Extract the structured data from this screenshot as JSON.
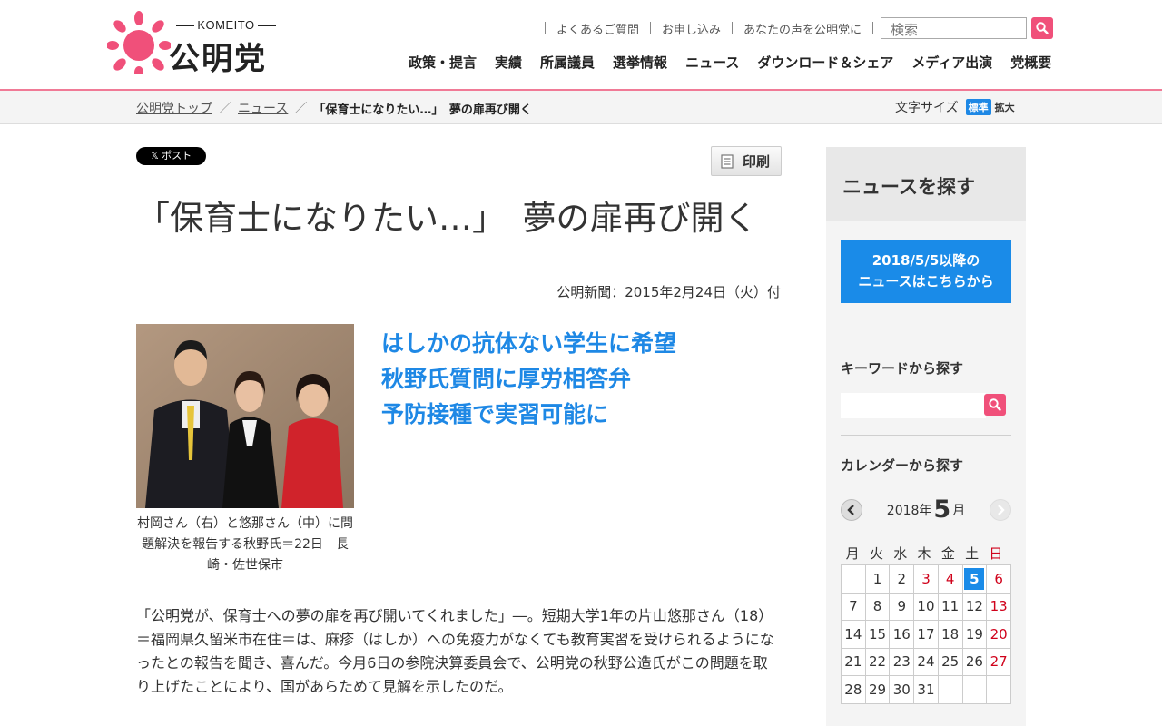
{
  "header": {
    "logo_sub": "KOMEITO",
    "logo_name": "公明党",
    "util_links": [
      "よくあるご質問",
      "お申し込み",
      "あなたの声を公明党に"
    ],
    "search_placeholder": "検索",
    "nav": [
      "政策・提言",
      "実績",
      "所属議員",
      "選挙情報",
      "ニュース",
      "ダウンロード＆シェア",
      "メディア出演",
      "党概要"
    ]
  },
  "breadcrumb": {
    "items": [
      "公明党トップ",
      "ニュース"
    ],
    "current": "「保育士になりたい…」　夢の扉再び開く"
  },
  "font_size": {
    "label": "文字サイズ",
    "standard": "標準",
    "large": "拡大"
  },
  "article": {
    "x_post_label": "ポスト",
    "print_label": "印刷",
    "title": "「保育士になりたい…」　夢の扉再び開く",
    "pub_date": "公明新聞：2015年2月24日（火）付",
    "caption": "村岡さん（右）と悠那さん（中）に問題解決を報告する秋野氏＝22日　長崎・佐世保市",
    "headlines": [
      "はしかの抗体ない学生に希望",
      "秋野氏質問に厚労相答弁",
      "予防接種で実習可能に"
    ],
    "body": "「公明党が、保育士への夢の扉を再び開いてくれました」―。短期大学1年の片山悠那さん（18）＝福岡県久留米市在住＝は、麻疹（はしか）への免疫力がなくても教育実習を受けられるようになったとの報告を聞き、喜んだ。今月6日の参院決算委員会で、公明党の秋野公造氏がこの問題を取り上げたことにより、国があらためて見解を示したのだ。"
  },
  "sidebar": {
    "heading": "ニュースを探す",
    "banner_line1": "2018/5/5以降の",
    "banner_line2": "ニュースはこちらから",
    "keyword_label": "キーワードから探す",
    "calendar_label": "カレンダーから探す",
    "calendar": {
      "year_text": "2018年",
      "month": "5",
      "month_suffix": "月",
      "weekdays": [
        "月",
        "火",
        "水",
        "木",
        "金",
        "土",
        "日"
      ],
      "weeks": [
        [
          "",
          "1",
          "2",
          "3",
          "4",
          "5",
          "6"
        ],
        [
          "7",
          "8",
          "9",
          "10",
          "11",
          "12",
          "13"
        ],
        [
          "14",
          "15",
          "16",
          "17",
          "18",
          "19",
          "20"
        ],
        [
          "21",
          "22",
          "23",
          "24",
          "25",
          "26",
          "27"
        ],
        [
          "28",
          "29",
          "30",
          "31",
          "",
          "",
          ""
        ]
      ],
      "holidays": [
        "3",
        "4"
      ],
      "today": "5"
    }
  },
  "colors": {
    "brand_pink": "#f0507a",
    "accent_blue": "#1e88e5",
    "holiday_red": "#d0021b"
  }
}
